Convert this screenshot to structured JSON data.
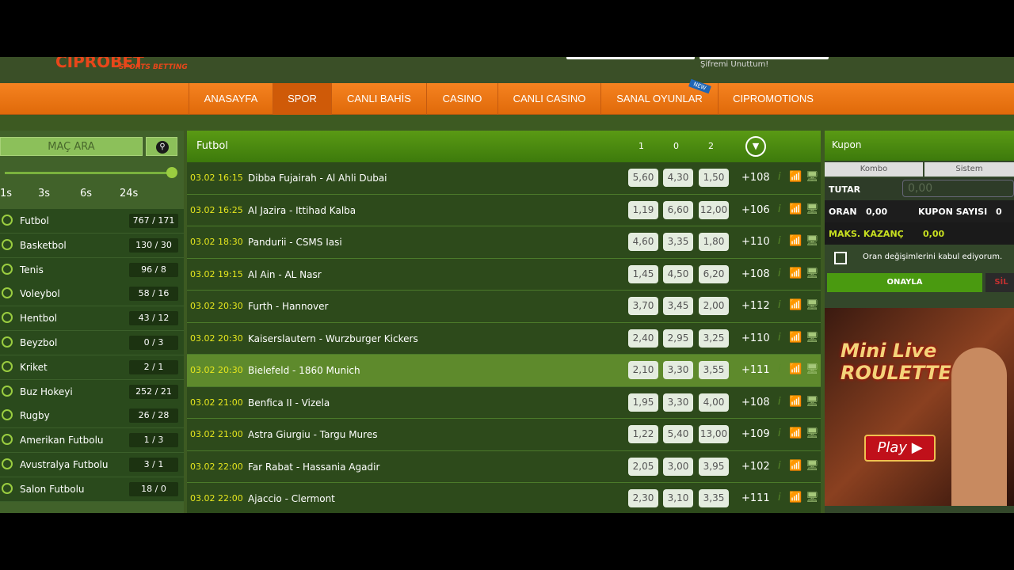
{
  "header": {
    "logo": "CIPROBET",
    "logo_sub": "SPORTS BETTING",
    "forgot_password": "Şifremi Unuttum!"
  },
  "nav": {
    "items": [
      "ANASAYFA",
      "SPOR",
      "CANLI BAHİS",
      "CASINO",
      "CANLI CASINO",
      "SANAL OYUNLAR",
      "CIPROMOTIONS"
    ],
    "active": "SPOR",
    "new_badge": "NEW"
  },
  "sidebar": {
    "search_placeholder": "MAÇ ARA",
    "search_icon": "search-icon",
    "slider_value": "24s",
    "ticks": [
      "1s",
      "3s",
      "6s",
      "24s"
    ],
    "sports": [
      {
        "name": "Futbol",
        "count": "767 / 171"
      },
      {
        "name": "Basketbol",
        "count": "130 / 30"
      },
      {
        "name": "Tenis",
        "count": "96 / 8"
      },
      {
        "name": "Voleybol",
        "count": "58 / 16"
      },
      {
        "name": "Hentbol",
        "count": "43 / 12"
      },
      {
        "name": "Beyzbol",
        "count": "0 / 3"
      },
      {
        "name": "Kriket",
        "count": "2 / 1"
      },
      {
        "name": "Buz Hokeyi",
        "count": "252 / 21"
      },
      {
        "name": "Rugby",
        "count": "26 / 28"
      },
      {
        "name": "Amerikan Futbolu",
        "count": "1 / 3"
      },
      {
        "name": "Avustralya Futbolu",
        "count": "3 / 1"
      },
      {
        "name": "Salon Futbolu",
        "count": "18 / 0"
      }
    ]
  },
  "main": {
    "title": "Futbol",
    "columns": [
      "1",
      "0",
      "2"
    ],
    "matches": [
      {
        "date": "03.02 16:15",
        "match": "Dibba Fujairah - Al Ahli Dubai",
        "odds": [
          "5,60",
          "4,30",
          "1,50"
        ],
        "more": "+108"
      },
      {
        "date": "03.02 16:25",
        "match": "Al Jazira - Ittihad Kalba",
        "odds": [
          "1,19",
          "6,60",
          "12,00"
        ],
        "more": "+106"
      },
      {
        "date": "03.02 18:30",
        "match": "Pandurii - CSMS Iasi",
        "odds": [
          "4,60",
          "3,35",
          "1,80"
        ],
        "more": "+110"
      },
      {
        "date": "03.02 19:15",
        "match": "Al Ain - AL Nasr",
        "odds": [
          "1,45",
          "4,50",
          "6,20"
        ],
        "more": "+108"
      },
      {
        "date": "03.02 20:30",
        "match": "Furth - Hannover",
        "odds": [
          "3,70",
          "3,45",
          "2,00"
        ],
        "more": "+112"
      },
      {
        "date": "03.02 20:30",
        "match": "Kaiserslautern - Wurzburger Kickers",
        "odds": [
          "2,40",
          "2,95",
          "3,25"
        ],
        "more": "+110"
      },
      {
        "date": "03.02 20:30",
        "match": "Bielefeld - 1860 Munich",
        "odds": [
          "2,10",
          "3,30",
          "3,55"
        ],
        "more": "+111"
      },
      {
        "date": "03.02 21:00",
        "match": "Benfica II - Vizela",
        "odds": [
          "1,95",
          "3,30",
          "4,00"
        ],
        "more": "+108"
      },
      {
        "date": "03.02 21:00",
        "match": "Astra Giurgiu - Targu Mures",
        "odds": [
          "1,22",
          "5,40",
          "13,00"
        ],
        "more": "+109"
      },
      {
        "date": "03.02 22:00",
        "match": "Far Rabat - Hassania Agadir",
        "odds": [
          "2,05",
          "3,00",
          "3,95"
        ],
        "more": "+102"
      },
      {
        "date": "03.02 22:00",
        "match": "Ajaccio - Clermont",
        "odds": [
          "2,30",
          "3,10",
          "3,35"
        ],
        "more": "+111"
      }
    ]
  },
  "coupon": {
    "title": "Kupon",
    "tabs": [
      "Kombo",
      "Sistem"
    ],
    "tutar_label": "TUTAR",
    "tutar_placeholder": "0,00",
    "oran_label": "ORAN",
    "oran_value": "0,00",
    "kupon_sayisi_label": "KUPON SAYISI",
    "kupon_sayisi_value": "0",
    "maks_label": "MAKS. KAZANÇ",
    "maks_value": "0,00",
    "accept_label": "Oran değişimlerini kabul ediyorum.",
    "confirm": "ONAYLA",
    "delete": "SİL"
  },
  "promo": {
    "title": "Mini Live ROULETTE",
    "play": "Play ▶"
  }
}
